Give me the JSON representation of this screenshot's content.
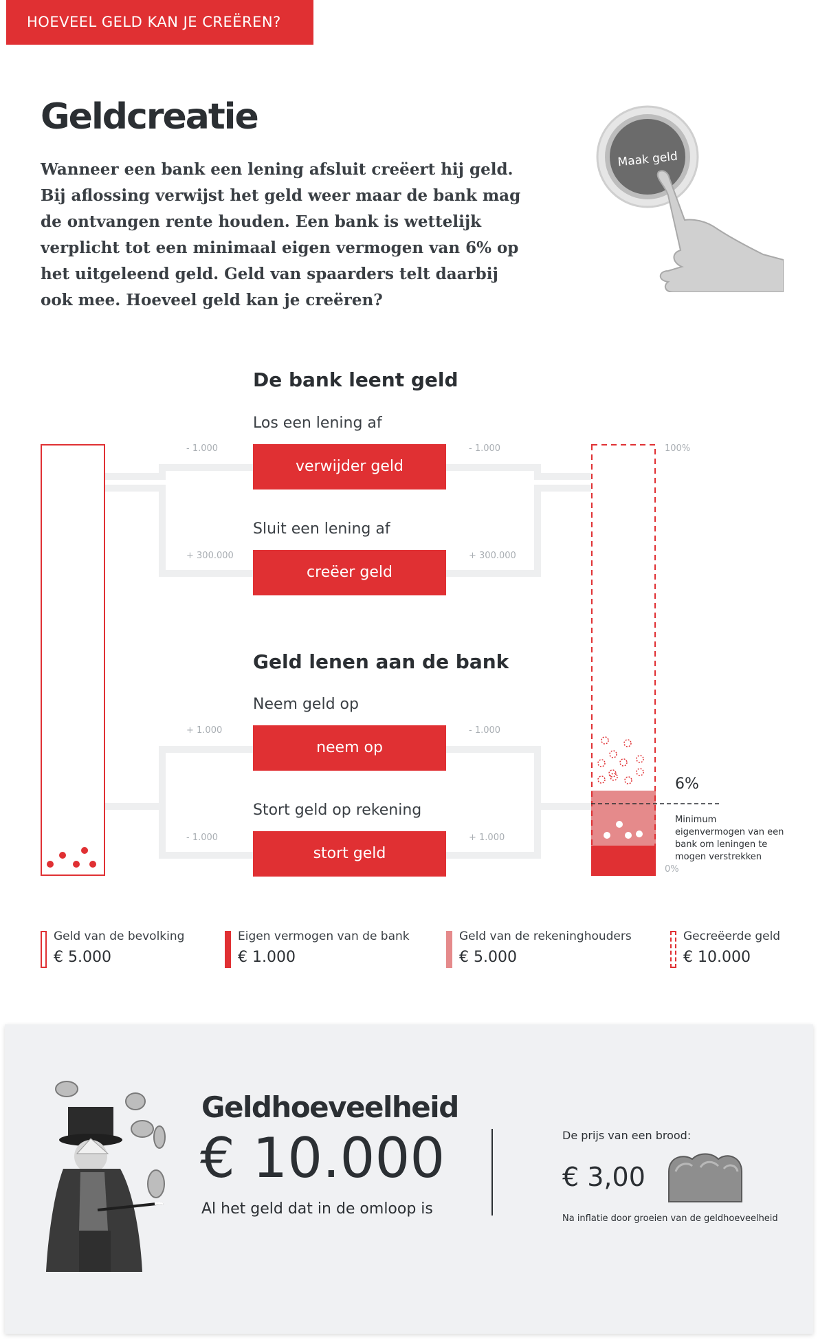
{
  "header": {
    "tag": "HOEVEEL GELD KAN JE CREËREN?"
  },
  "intro": {
    "title": "Geldcreatie",
    "text": "Wanneer een bank een lening afsluit creëert hij geld. Bij aflossing verwijst het geld weer maar de bank mag de ontvangen rente houden. Een bank is wettelijk verplicht tot een minimaal eigen vermogen van 6% op het uitgeleend geld. Geld van spaarders telt daarbij ook mee. Hoeveel geld kan je creëren?",
    "button_image_text": "Maak geld"
  },
  "lending": {
    "heading": "De bank leent geld",
    "repay": {
      "label": "Los een lening af",
      "button": "verwijder geld",
      "delta_left": "- 1.000",
      "delta_right": "- 1.000"
    },
    "create": {
      "label": "Sluit een lening af",
      "button": "creëer geld",
      "delta_left": "+ 300.000",
      "delta_right": "+ 300.000"
    }
  },
  "borrowing": {
    "heading": "Geld lenen aan de bank",
    "withdraw": {
      "label": "Neem geld op",
      "button": "neem op",
      "delta_left": "+ 1.000",
      "delta_right": "- 1.000"
    },
    "deposit": {
      "label": "Stort geld op rekening",
      "button": "stort geld",
      "delta_left": "- 1.000",
      "delta_right": "+ 1.000"
    }
  },
  "bank_tube": {
    "top_label": "100%",
    "bottom_label": "0%",
    "min_label": "6%",
    "min_note": "Minimum eigenvermogen van een bank om leningen te mogen verstrekken",
    "min_fraction": 0.06
  },
  "colors": {
    "accent": "#e03033",
    "accent_light": "#e58a8b",
    "panel": "#f0f1f3",
    "connector": "#eeeff0"
  },
  "legend": [
    {
      "label": "Geld van de bevolking",
      "value": "€ 5.000",
      "style": "outline"
    },
    {
      "label": "Eigen vermogen van de bank",
      "value": "€ 1.000",
      "style": "solid"
    },
    {
      "label": "Geld van de rekeninghouders",
      "value": "€ 5.000",
      "style": "light"
    },
    {
      "label": "Gecreëerde geld",
      "value": "€ 10.000",
      "style": "dashed"
    }
  ],
  "money_supply": {
    "title": "Geldhoeveelheid",
    "amount": "€ 10.000",
    "description": "Al het geld dat in de omloop is",
    "bread_label": "De prijs van een brood:",
    "bread_price": "€ 3,00",
    "bread_note": "Na inflatie door groeien van de geldhoeveelheid"
  }
}
